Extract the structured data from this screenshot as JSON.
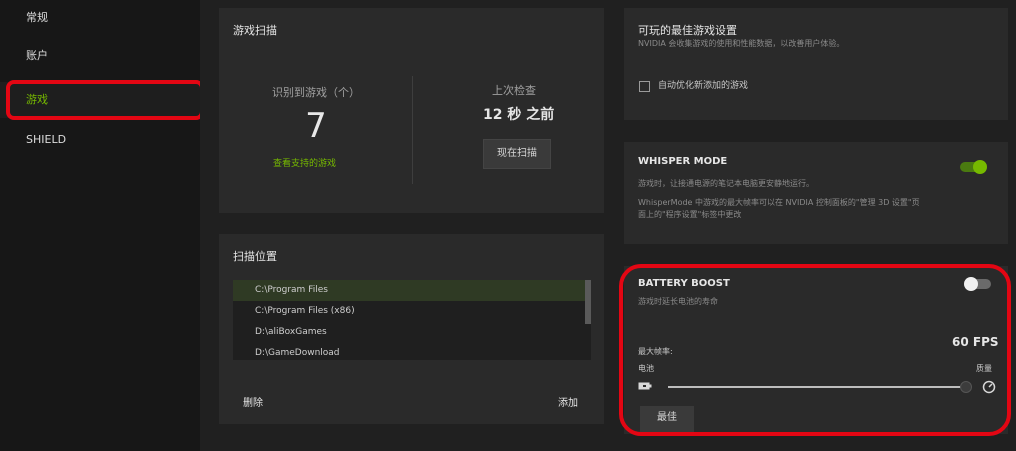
{
  "sidebar": {
    "items": [
      {
        "label": "常规"
      },
      {
        "label": "账户"
      },
      {
        "label": "游戏"
      },
      {
        "label": "SHIELD"
      }
    ]
  },
  "scan": {
    "title": "游戏扫描",
    "games_label": "识别到游戏（个）",
    "games_count": "7",
    "supported_link": "查看支持的游戏",
    "last_check_label": "上次检查",
    "last_check_value": "12 秒 之前",
    "scan_now": "现在扫描"
  },
  "locations": {
    "title": "扫描位置",
    "paths": [
      "C:\\Program Files",
      "C:\\Program Files (x86)",
      "D:\\aliBoxGames",
      "D:\\GameDownload"
    ],
    "delete": "删除",
    "add": "添加"
  },
  "optimal": {
    "title": "可玩的最佳游戏设置",
    "desc": "NVIDIA 会收集游戏的使用和性能数据，以改善用户体验。",
    "auto_optimize": "自动优化新添加的游戏"
  },
  "whisper": {
    "title": "WHISPER MODE",
    "desc1": "游戏时，让接通电源的笔记本电脑更安静地运行。",
    "desc2a": "WhisperMode 中游戏的最大帧率可以在 NVIDIA 控制面板的\"管理 3D 设置\"页",
    "desc2b": "面上的\"程序设置\"标签中更改"
  },
  "battery": {
    "title": "BATTERY BOOST",
    "desc": "游戏时延长电池的寿命",
    "max_fps_label": "最大帧率:",
    "fps_value": "60 FPS",
    "battery_label": "电池",
    "quality_label": "质量",
    "optimal_btn": "最佳",
    "slider_level": 1.0
  },
  "colors": {
    "accent": "#76b900",
    "highlight": "#e30613"
  }
}
